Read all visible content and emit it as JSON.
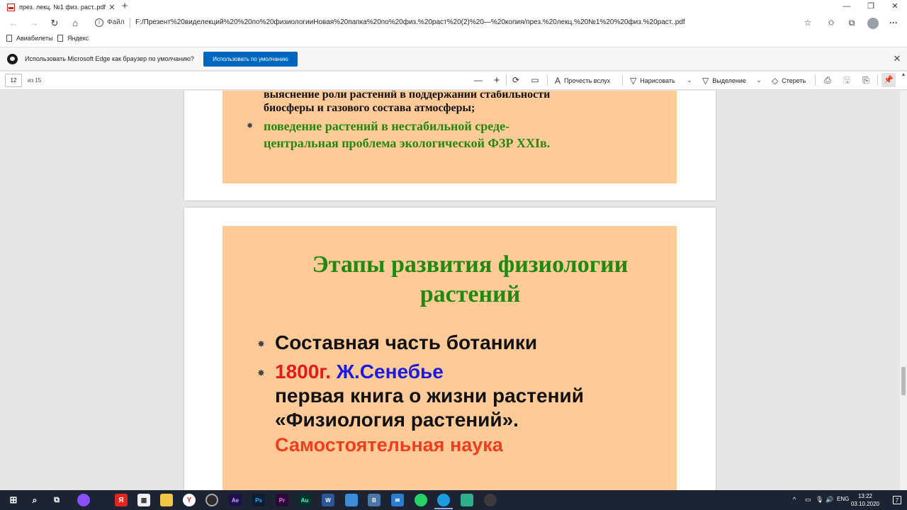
{
  "browser": {
    "tab": {
      "title": "през. лекц. №1 физ. раст..pdf",
      "close": "✕"
    },
    "new_tab": "+",
    "window_controls": [
      "—",
      "❐",
      "✕"
    ],
    "nav": {
      "back": "←",
      "forward": "→",
      "refresh": "↻",
      "home": "⌂"
    },
    "address": {
      "info": "i",
      "scheme_label": "Файл",
      "url": "F:/Презент%20виделекций%20%20по%20физиологииНовая%20папка%20по%20физ.%20раст%20(2)%20—%20копия/през.%20лекц.%20№1%20%20физ.%20раст..pdf"
    },
    "right_icons": {
      "favorite": "☆",
      "favorites_list": "✩",
      "collections": "⧉"
    },
    "favorites": [
      "Авиабилеты",
      "Яндекс"
    ]
  },
  "infobar": {
    "message": "Использовать Microsoft Edge как браузер по умолчанию?",
    "button": "Использовать по умолчанию",
    "close": "✕"
  },
  "pdf_toolbar": {
    "page_current": "12",
    "page_total": "из 15",
    "zoom_out": "—",
    "zoom_in": "+",
    "rotate": "⟳",
    "fit": "▭",
    "read_aloud": "Прочесть вслух",
    "draw": "Нарисовать",
    "highlight": "Выделение",
    "erase": "Стереть",
    "print": "⎙",
    "save": "🖫",
    "save_as": "⎘",
    "pin": "📌"
  },
  "slide_prev": {
    "line1": "выяснение роли растений в поддержании стабильности",
    "line2": "биосферы и газового состава атмосферы;",
    "bullet_a": "поведение растений в нестабильной среде-",
    "bullet_b": "центральная проблема экологической ФЗР XXIв.",
    "star": "✸"
  },
  "slide_current": {
    "title_line1": "Этапы развития физиологии",
    "title_line2": "растений",
    "bullet1": "Составная часть ботаники",
    "bullet2_year": "1800г.",
    "bullet2_name": "Ж.Сенебье",
    "bullet2_line2": "первая книга о жизни растений",
    "bullet2_line3": "«Физиология растений».",
    "bullet2_line4": "Самостоятельная наука",
    "star": "✸"
  },
  "colors": {
    "slide_bg": "#fdca98",
    "title_green": "#1f8a0f",
    "year_red": "#e41b1b",
    "name_blue": "#1a1ae0",
    "science_red": "#ef3e1e",
    "taskbar_bg": "#1c2434",
    "edge_button": "#0067c0"
  },
  "taskbar": {
    "icons": [
      "windows-start",
      "search",
      "task-view",
      "alice",
      "yandex",
      "store",
      "file-explorer",
      "yandex-browser",
      "obs",
      "after-effects",
      "photoshop",
      "premiere",
      "audition",
      "word",
      "media",
      "vk",
      "mail",
      "whatsapp",
      "edge",
      "chat",
      "xbox"
    ],
    "labels": {
      "ae": "Ae",
      "ps": "Ps",
      "pr": "Pr",
      "au": "Au",
      "word": "W",
      "vk": "В",
      "yandex": "Я"
    },
    "tray": {
      "up": "^",
      "lang": "ENG"
    },
    "time": "13:22",
    "date": "03.10.2020",
    "notifications": "7"
  }
}
